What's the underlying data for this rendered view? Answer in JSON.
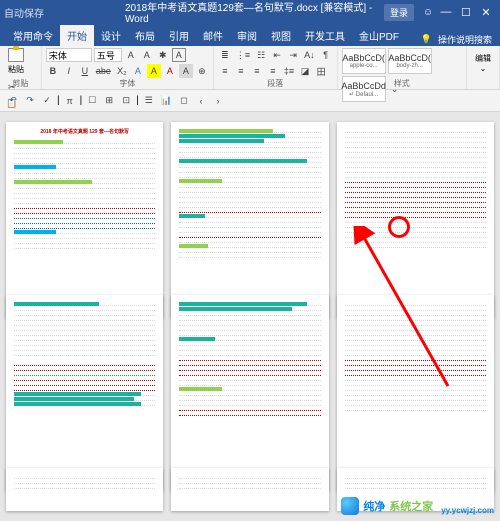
{
  "titlebar": {
    "autosave_label": "自动保存",
    "title": "2018年中考语文真题129套—名句默写.docx [兼容模式] - Word",
    "login": "登录",
    "icons": {
      "face": "☺",
      "min": "—",
      "restore": "☐",
      "close": "✕"
    }
  },
  "tabs": [
    "常用命令",
    "开始",
    "设计",
    "布局",
    "引用",
    "邮件",
    "审阅",
    "视图",
    "开发工具",
    "金山PDF"
  ],
  "help": {
    "search": "操作说明搜索"
  },
  "ribbon": {
    "clipboard": {
      "paste": "粘贴",
      "label": "剪贴"
    },
    "font": {
      "name": "宋体",
      "size": "五号",
      "buttons": [
        "B",
        "I",
        "U",
        "abe",
        "X₂",
        "ᴬᴬ",
        "ᴬᴬ",
        "A"
      ],
      "mini": [
        "A",
        "A"
      ],
      "label": "字体"
    },
    "paragraph": {
      "buttons": [
        "≡",
        "≡",
        "≡",
        "≡",
        "⋮≡",
        "A↓",
        "¶",
        "☰",
        "田"
      ],
      "label": "段落"
    },
    "styles": {
      "items": [
        {
          "sample": "AaBbCcD(",
          "name": "apple-co..."
        },
        {
          "sample": "AaBbCcD(",
          "name": "body-zh..."
        },
        {
          "sample": "AaBbCcDd",
          "name": "↵ Defaul..."
        }
      ],
      "label": "样式"
    },
    "editing": {
      "label": "编辑"
    }
  },
  "qat": [
    "↶",
    "↷",
    "✓",
    "—",
    "π",
    "—",
    "☐",
    "⊞",
    "⊡",
    "—",
    "☰",
    "📊",
    "◻",
    "‹",
    "›"
  ],
  "pages": {
    "p1": {
      "title": "2018 年中考语文真题 129 套—名句默写"
    }
  },
  "watermark": {
    "t1": "纯净",
    "t2": "系统之家",
    "url": "yy.ycwjzj.com"
  }
}
